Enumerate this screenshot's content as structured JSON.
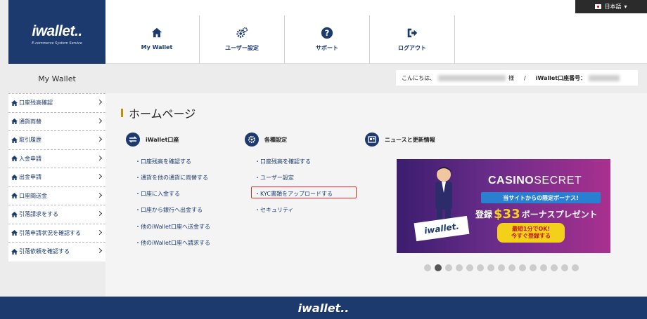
{
  "brand": {
    "logo_text": "iwallet..",
    "logo_tagline": "E-commerce System Service",
    "footer_logo": "iwallet.."
  },
  "language": {
    "label": "日本語"
  },
  "nav": [
    {
      "label": "My Wallet",
      "icon": "home-icon"
    },
    {
      "label": "ユーザー設定",
      "icon": "gears-icon"
    },
    {
      "label": "サポート",
      "icon": "question-icon"
    },
    {
      "label": "ログアウト",
      "icon": "logout-icon"
    }
  ],
  "sub_header": {
    "title": "My Wallet"
  },
  "greeting": {
    "prefix": "こんにちは、",
    "suffix": "様",
    "separator": "/",
    "account_label": "iWallet口座番号："
  },
  "sidebar": [
    {
      "label": "口座残高確認"
    },
    {
      "label": "通貨両替"
    },
    {
      "label": "取引履歴"
    },
    {
      "label": "入金申請"
    },
    {
      "label": "出金申請"
    },
    {
      "label": "口座間送金"
    },
    {
      "label": "引落請求をする"
    },
    {
      "label": "引落申請状況を確認する"
    },
    {
      "label": "引落依頼を確認する"
    }
  ],
  "page_title": "ホームページ",
  "sections": {
    "wallet": {
      "title": "iWallet口座",
      "links": [
        "・口座残高を確認する",
        "・通貨を他の通貨に両替する",
        "・口座に入金する",
        "・口座から銀行へ出金する",
        "・他のiWallet口座へ送金する",
        "・他のiWallet口座へ請求する"
      ]
    },
    "settings": {
      "title": "各種設定",
      "links": [
        "・口座残高を確認する",
        "・ユーザー設定",
        "・KYC書類をアップロードする",
        "・セキュリティ"
      ]
    },
    "news": {
      "title": "ニュースと更新情報"
    }
  },
  "banner": {
    "brand_a": "CASINO",
    "brand_b": "SECRET",
    "limited": "当サイトからの限定ボーナス!",
    "bonus_prefix": "登録",
    "bonus_amount": "$33",
    "bonus_suffix": "ボーナスプレゼント",
    "cta_line1": "最短1分でOK!",
    "cta_line2": "今すぐ登録する",
    "wallet_logo": "iwallet."
  },
  "carousel": {
    "count": 15,
    "active": 1
  },
  "colors": {
    "primary": "#1c3a6e",
    "accent": "#b7950b",
    "highlight": "#d93025"
  }
}
